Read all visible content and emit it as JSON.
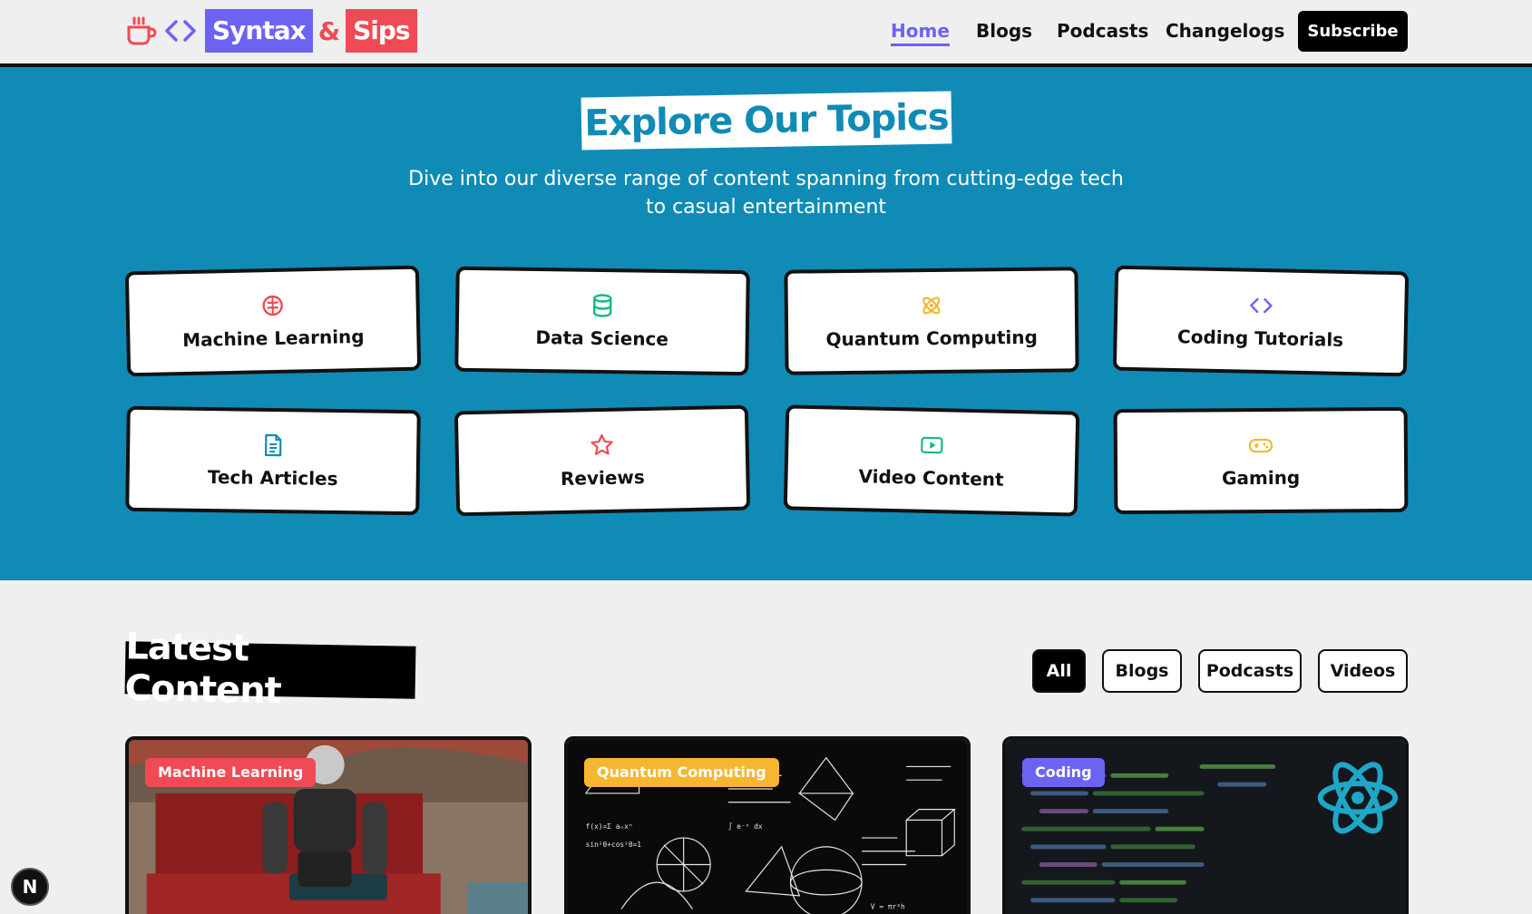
{
  "brand": {
    "word1": "Syntax",
    "amp": "&",
    "word2": "Sips"
  },
  "nav": {
    "items": [
      {
        "label": "Home",
        "active": true
      },
      {
        "label": "Blogs",
        "active": false
      },
      {
        "label": "Podcasts",
        "active": false
      },
      {
        "label": "Changelogs",
        "active": false
      }
    ],
    "subscribe": "Subscribe"
  },
  "topics": {
    "title": "Explore Our Topics",
    "subtitle": "Dive into our diverse range of content spanning from cutting-edge tech to casual entertainment",
    "cards": [
      {
        "label": "Machine Learning",
        "icon": "brain-icon",
        "color": "#f04a55"
      },
      {
        "label": "Data Science",
        "icon": "database-icon",
        "color": "#12b886"
      },
      {
        "label": "Quantum Computing",
        "icon": "atom-icon",
        "color": "#f5b731"
      },
      {
        "label": "Coding Tutorials",
        "icon": "code-icon",
        "color": "#6c63f2"
      },
      {
        "label": "Tech Articles",
        "icon": "document-icon",
        "color": "#108bb6"
      },
      {
        "label": "Reviews",
        "icon": "star-icon",
        "color": "#f04a55"
      },
      {
        "label": "Video Content",
        "icon": "video-play-icon",
        "color": "#12b886"
      },
      {
        "label": "Gaming",
        "icon": "gamepad-icon",
        "color": "#f5b731"
      }
    ]
  },
  "latest": {
    "title": "Latest Content",
    "filters": [
      {
        "label": "All",
        "active": true
      },
      {
        "label": "Blogs",
        "active": false
      },
      {
        "label": "Podcasts",
        "active": false
      },
      {
        "label": "Videos",
        "active": false
      }
    ],
    "posts": [
      {
        "tag": "Machine Learning",
        "tag_color": "#f04a55"
      },
      {
        "tag": "Quantum Computing",
        "tag_color": "#f5b731"
      },
      {
        "tag": "Coding",
        "tag_color": "#6c63f2"
      }
    ]
  },
  "dev_badge": "N"
}
